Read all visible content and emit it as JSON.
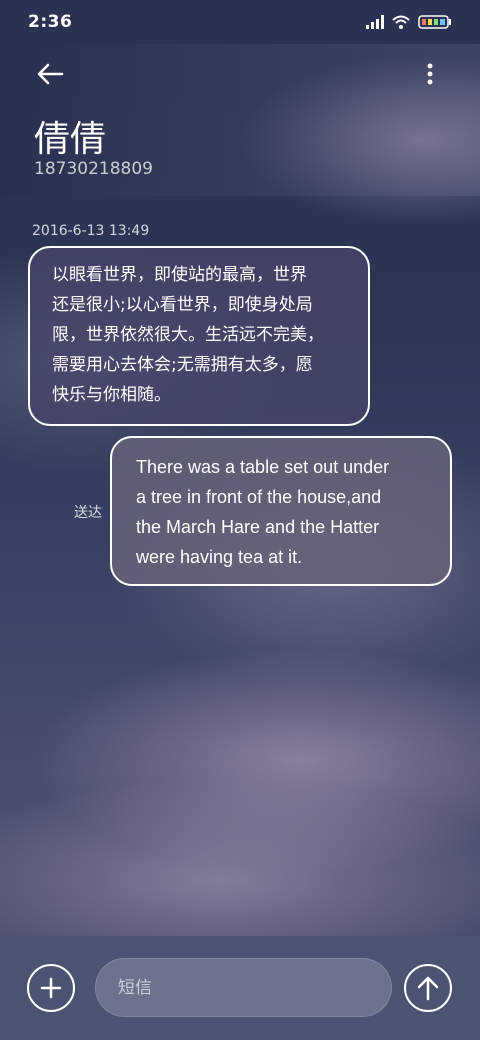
{
  "status_bar": {
    "time": "2:36",
    "icons": [
      "signal-icon",
      "wifi-icon",
      "battery-icon"
    ]
  },
  "header": {
    "back_icon": "arrow-left-icon",
    "more_icon": "more-vertical-icon",
    "contact_name": "倩倩",
    "contact_number": "18730218809"
  },
  "conversation": {
    "timestamp": "2016-6-13 13:49",
    "messages": [
      {
        "direction": "incoming",
        "lines": [
          "以眼看世界，即使站的最高，世界",
          "还是很小;以心看世界，即使身处局",
          "限，世界依然很大。生活远不完美，",
          "需要用心去体会;无需拥有太多，愿",
          "快乐与你相随。"
        ]
      },
      {
        "direction": "outgoing",
        "status": "送达",
        "lines": [
          "There was a table set out under",
          "a tree in front of the house,and",
          "the March Hare and the Hatter",
          "were having tea at it."
        ]
      }
    ]
  },
  "composer": {
    "add_icon": "plus-circle-icon",
    "placeholder": "短信",
    "send_icon": "arrow-up-circle-icon"
  }
}
